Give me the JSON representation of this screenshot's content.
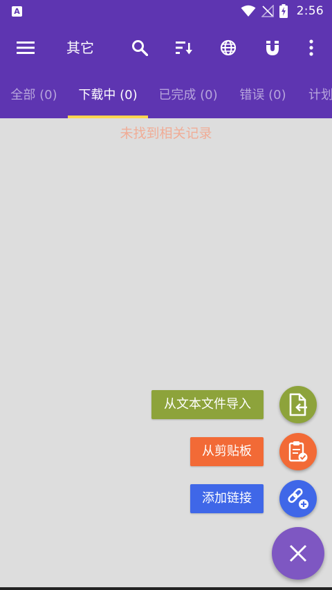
{
  "status_bar": {
    "time": "2:56"
  },
  "toolbar": {
    "title": "其它",
    "icons": [
      "menu-icon",
      "search-icon",
      "sort-icon",
      "globe-icon",
      "magnet-icon",
      "more-vert-icon"
    ]
  },
  "tabs": [
    {
      "label": "全部 (0)",
      "active": false
    },
    {
      "label": "下载中 (0)",
      "active": true
    },
    {
      "label": "已完成 (0)",
      "active": false
    },
    {
      "label": "错误 (0)",
      "active": false
    },
    {
      "label": "计划",
      "active": false
    }
  ],
  "empty_state": {
    "text": "未找到相关记录"
  },
  "fab_menu": {
    "items": [
      {
        "label": "从文本文件导入",
        "icon": "file-import-icon",
        "color": "#8da33b"
      },
      {
        "label": "从剪贴板",
        "icon": "clipboard-check-icon",
        "color": "#f26a36"
      },
      {
        "label": "添加链接",
        "icon": "link-add-icon",
        "color": "#3f67e8"
      }
    ],
    "main_icon": "close-icon",
    "main_color": "#7e57c2"
  },
  "colors": {
    "primary": "#5e35b1",
    "indicator": "#ffd54f",
    "background": "#dddddd"
  }
}
